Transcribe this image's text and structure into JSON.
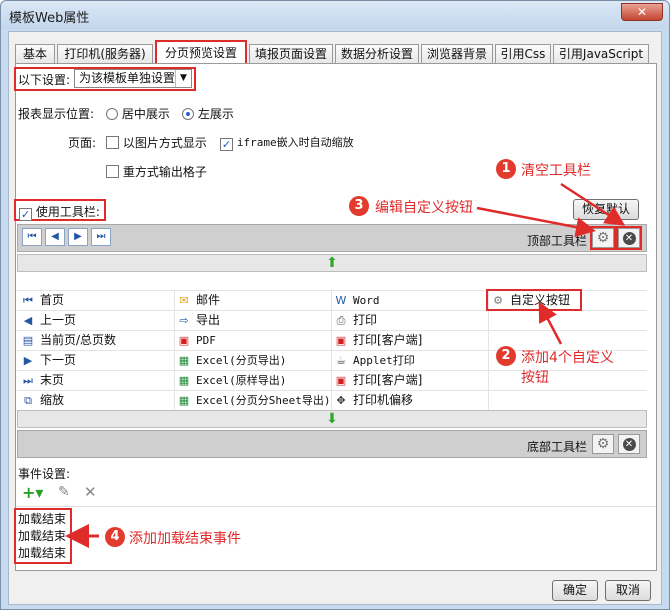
{
  "window": {
    "title": "模板Web属性",
    "close_glyph": "✕"
  },
  "tabs": [
    {
      "label": "基本"
    },
    {
      "label": "打印机(服务器)"
    },
    {
      "label": "分页预览设置"
    },
    {
      "label": "填报页面设置"
    },
    {
      "label": "数据分析设置"
    },
    {
      "label": "浏览器背景"
    },
    {
      "label": "引用Css"
    },
    {
      "label": "引用JavaScript"
    }
  ],
  "settings": {
    "scope_label": "以下设置:",
    "scope_value": "为该模板单独设置",
    "position_label": "报表显示位置:",
    "position_center": "居中展示",
    "position_left": "左展示",
    "page_label": "页面:",
    "page_image": "以图片方式显示",
    "page_iframe": "iframe嵌入时自动缩放",
    "page_repeat": "重方式输出格子",
    "use_toolbar": "使用工具栏:",
    "restore_default": "恢复默认"
  },
  "toolbar": {
    "top_label": "顶部工具栏",
    "bottom_label": "底部工具栏",
    "nav_first": "⏮",
    "nav_prev": "◀",
    "nav_next": "▶",
    "nav_last": "⏭"
  },
  "items": {
    "col1": [
      "首页",
      "上一页",
      "当前页/总页数",
      "下一页",
      "末页",
      "缩放"
    ],
    "col2": [
      "邮件",
      "导出",
      "PDF",
      "Excel(分页导出)",
      "Excel(原样导出)",
      "Excel(分页分Sheet导出)"
    ],
    "col3": [
      "Word",
      "打印",
      "打印[客户端]",
      "Applet打印",
      "打印[客户端]",
      "打印机偏移"
    ],
    "col4": [
      "自定义按钮"
    ]
  },
  "events": {
    "label": "事件设置:",
    "list": [
      "加载结束",
      "加载结束",
      "加载结束"
    ]
  },
  "annotations": {
    "a1_num": "1",
    "a1_text": "清空工具栏",
    "a2_num": "2",
    "a2_text_1": "添加4个自定义",
    "a2_text_2": "按钮",
    "a3_num": "3",
    "a3_text": "编辑自定义按钮",
    "a4_num": "4",
    "a4_text": "添加加载结束事件"
  },
  "footer": {
    "ok": "确定",
    "cancel": "取消"
  },
  "colors": {
    "accent_red": "#e02b2b",
    "window_blue": "#c6dbef"
  }
}
